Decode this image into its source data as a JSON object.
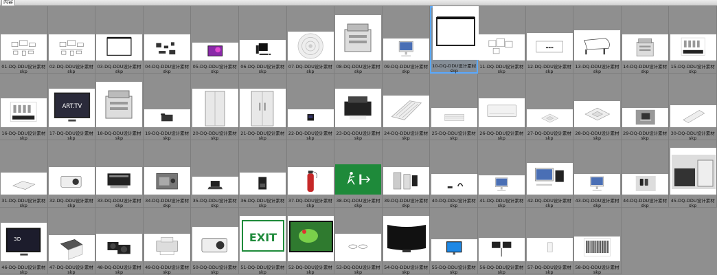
{
  "window": {
    "title": "内容"
  },
  "items": [
    {
      "label": "01-DQ-DDU设计素材",
      "ext": "skp",
      "icon": "furniture-set-icon",
      "thumb_bg": "#ffffff"
    },
    {
      "label": "02-DQ-DDU设计素材",
      "ext": "skp",
      "icon": "furniture-set-icon",
      "thumb_bg": "#ffffff"
    },
    {
      "label": "03-DQ-DDU设计素材",
      "ext": "skp",
      "icon": "projector-screen-icon",
      "thumb_bg": "#ffffff"
    },
    {
      "label": "04-DQ-DDU设计素材",
      "ext": "skp",
      "icon": "desk-accessories-icon",
      "thumb_bg": "#ffffff"
    },
    {
      "label": "05-DQ-DDU设计素材",
      "ext": "skp",
      "icon": "monitor-purple-icon",
      "thumb_bg": "#ffffff"
    },
    {
      "label": "06-DQ-DDU设计素材",
      "ext": "skp",
      "icon": "computer-set-icon",
      "thumb_bg": "#ffffff"
    },
    {
      "label": "07-DQ-DDU设计素材",
      "ext": "skp",
      "icon": "ceiling-vent-icon",
      "thumb_bg": "#ffffff"
    },
    {
      "label": "08-DQ-DDU设计素材",
      "ext": "skp",
      "icon": "copier-icon",
      "thumb_bg": "#ffffff"
    },
    {
      "label": "09-DQ-DDU设计素材",
      "ext": "skp",
      "icon": "imac-icon",
      "thumb_bg": "#ffffff"
    },
    {
      "label": "10-DQ-DDU设计素材",
      "ext": "skp",
      "icon": "projector-screen-icon",
      "thumb_bg": "#ffffff"
    },
    {
      "label": "11-DQ-DDU设计素材",
      "ext": "skp",
      "icon": "sofa-set-icon",
      "thumb_bg": "#ffffff"
    },
    {
      "label": "12-DQ-DDU设计素材",
      "ext": "skp",
      "icon": "branded-shelf-icon",
      "thumb_bg": "#ffffff"
    },
    {
      "label": "13-DQ-DDU设计素材",
      "ext": "skp",
      "icon": "grand-piano-icon",
      "thumb_bg": "#ffffff"
    },
    {
      "label": "14-DQ-DDU设计素材",
      "ext": "skp",
      "icon": "office-copier-icon",
      "thumb_bg": "#ffffff"
    },
    {
      "label": "15-DQ-DDU设计素材",
      "ext": "skp",
      "icon": "branded-pack-icon",
      "thumb_bg": "#ffffff"
    },
    {
      "label": "16-DQ-DDU设计素材",
      "ext": "skp",
      "icon": "branded-pack-icon",
      "thumb_bg": "#ffffff"
    },
    {
      "label": "17-DQ-DDU设计素材",
      "ext": "skp",
      "icon": "smart-tv-icon",
      "thumb_bg": "#ffffff"
    },
    {
      "label": "18-DQ-DDU设计素材",
      "ext": "skp",
      "icon": "office-copier-icon",
      "thumb_bg": "#ffffff"
    },
    {
      "label": "19-DQ-DDU设计素材",
      "ext": "skp",
      "icon": "desk-phone-icon",
      "thumb_bg": "#ffffff"
    },
    {
      "label": "20-DQ-DDU设计素材",
      "ext": "skp",
      "icon": "refrigerator-icon",
      "thumb_bg": "#ffffff"
    },
    {
      "label": "21-DQ-DDU设计素材",
      "ext": "skp",
      "icon": "refrigerator-double-icon",
      "thumb_bg": "#ffffff"
    },
    {
      "label": "22-DQ-DDU设计素材",
      "ext": "skp",
      "icon": "phone-base-icon",
      "thumb_bg": "#ffffff"
    },
    {
      "label": "23-DQ-DDU设计素材",
      "ext": "skp",
      "icon": "printer-icon",
      "thumb_bg": "#ffffff"
    },
    {
      "label": "24-DQ-DDU设计素材",
      "ext": "skp",
      "icon": "vent-panel-icon",
      "thumb_bg": "#ffffff"
    },
    {
      "label": "25-DQ-DDU设计素材",
      "ext": "skp",
      "icon": "vent-grille-icon",
      "thumb_bg": "#ffffff"
    },
    {
      "label": "26-DQ-DDU设计素材",
      "ext": "skp",
      "icon": "air-conditioner-icon",
      "thumb_bg": "#ffffff"
    },
    {
      "label": "27-DQ-DDU设计素材",
      "ext": "skp",
      "icon": "ceiling-cassette-icon",
      "thumb_bg": "#ffffff"
    },
    {
      "label": "28-DQ-DDU设计素材",
      "ext": "skp",
      "icon": "ceiling-cassette-icon",
      "thumb_bg": "#ffffff"
    },
    {
      "label": "29-DQ-DDU设计素材",
      "ext": "skp",
      "icon": "laptop-photo-icon",
      "thumb_bg": "#ffffff"
    },
    {
      "label": "30-DQ-DDU设计素材",
      "ext": "skp",
      "icon": "keyboard-icon",
      "thumb_bg": "#ffffff"
    },
    {
      "label": "31-DQ-DDU设计素材",
      "ext": "skp",
      "icon": "scanner-icon",
      "thumb_bg": "#ffffff"
    },
    {
      "label": "32-DQ-DDU设计素材",
      "ext": "skp",
      "icon": "projector-icon",
      "thumb_bg": "#ffffff"
    },
    {
      "label": "33-DQ-DDU设计素材",
      "ext": "skp",
      "icon": "printer-box-icon",
      "thumb_bg": "#ffffff"
    },
    {
      "label": "34-DQ-DDU设计素材",
      "ext": "skp",
      "icon": "camera-icon",
      "thumb_bg": "#ffffff"
    },
    {
      "label": "35-DQ-DDU设计素材",
      "ext": "skp",
      "icon": "laptop-icon",
      "thumb_bg": "#ffffff"
    },
    {
      "label": "36-DQ-DDU设计素材",
      "ext": "skp",
      "icon": "coffee-machine-icon",
      "thumb_bg": "#ffffff"
    },
    {
      "label": "37-DQ-DDU设计素材",
      "ext": "skp",
      "icon": "fire-extinguisher-icon",
      "thumb_bg": "#ffffff"
    },
    {
      "label": "38-DQ-DDU设计素材",
      "ext": "skp",
      "icon": "exit-sign-green-icon",
      "thumb_bg": "#1e8a3a"
    },
    {
      "label": "39-DQ-DDU设计素材",
      "ext": "skp",
      "icon": "appliances-icon",
      "thumb_bg": "#ffffff"
    },
    {
      "label": "40-DQ-DDU设计素材",
      "ext": "skp",
      "icon": "headphones-icon",
      "thumb_bg": "#ffffff"
    },
    {
      "label": "41-DQ-DDU设计素材",
      "ext": "skp",
      "icon": "imac-icon",
      "thumb_bg": "#ffffff"
    },
    {
      "label": "42-DQ-DDU设计素材",
      "ext": "skp",
      "icon": "apple-devices-icon",
      "thumb_bg": "#ffffff"
    },
    {
      "label": "43-DQ-DDU设计素材",
      "ext": "skp",
      "icon": "imac-icon",
      "thumb_bg": "#ffffff"
    },
    {
      "label": "44-DQ-DDU设计素材",
      "ext": "skp",
      "icon": "phones-icon",
      "thumb_bg": "#ffffff"
    },
    {
      "label": "45-DQ-DDU设计素材",
      "ext": "skp",
      "icon": "kitchen-icon",
      "thumb_bg": "#ffffff"
    },
    {
      "label": "46-DQ-DDU设计素材",
      "ext": "skp",
      "icon": "tv-3d-icon",
      "thumb_bg": "#ffffff"
    },
    {
      "label": "47-DQ-DDU设计素材",
      "ext": "skp",
      "icon": "tv-box-icon",
      "thumb_bg": "#ffffff"
    },
    {
      "label": "48-DQ-DDU设计素材",
      "ext": "skp",
      "icon": "dslr-cameras-icon",
      "thumb_bg": "#ffffff"
    },
    {
      "label": "49-DQ-DDU设计素材",
      "ext": "skp",
      "icon": "photo-printer-icon",
      "thumb_bg": "#ffffff"
    },
    {
      "label": "50-DQ-DDU设计素材",
      "ext": "skp",
      "icon": "projector-icon",
      "thumb_bg": "#ffffff"
    },
    {
      "label": "51-DQ-DDU设计素材",
      "ext": "skp",
      "icon": "exit-sign-icon",
      "thumb_bg": "#ffffff",
      "exit_text": "EXIT"
    },
    {
      "label": "52-DQ-DDU设计素材",
      "ext": "skp",
      "icon": "tv-frog-icon",
      "thumb_bg": "#ffffff"
    },
    {
      "label": "53-DQ-DDU设计素材",
      "ext": "skp",
      "icon": "ceiling-lights-icon",
      "thumb_bg": "#ffffff"
    },
    {
      "label": "54-DQ-DDU设计素材",
      "ext": "skp",
      "icon": "curved-tv-icon",
      "thumb_bg": "#ffffff"
    },
    {
      "label": "55-DQ-DDU设计素材",
      "ext": "skp",
      "icon": "monitor-blue-icon",
      "thumb_bg": "#ffffff"
    },
    {
      "label": "56-DQ-DDU设计素材",
      "ext": "skp",
      "icon": "monitor-arms-icon",
      "thumb_bg": "#ffffff"
    },
    {
      "label": "57-DQ-DDU设计素材",
      "ext": "skp",
      "icon": "wall-switch-icon",
      "thumb_bg": "#ffffff"
    },
    {
      "label": "58-DQ-DDU设计素材",
      "ext": "skp",
      "icon": "barcode-icon",
      "thumb_bg": "#ffffff"
    }
  ],
  "selected_index": 9,
  "colors": {
    "selection": "#5aa9ff",
    "background": "#8f8f8f",
    "exit_green": "#1e8a3a"
  }
}
